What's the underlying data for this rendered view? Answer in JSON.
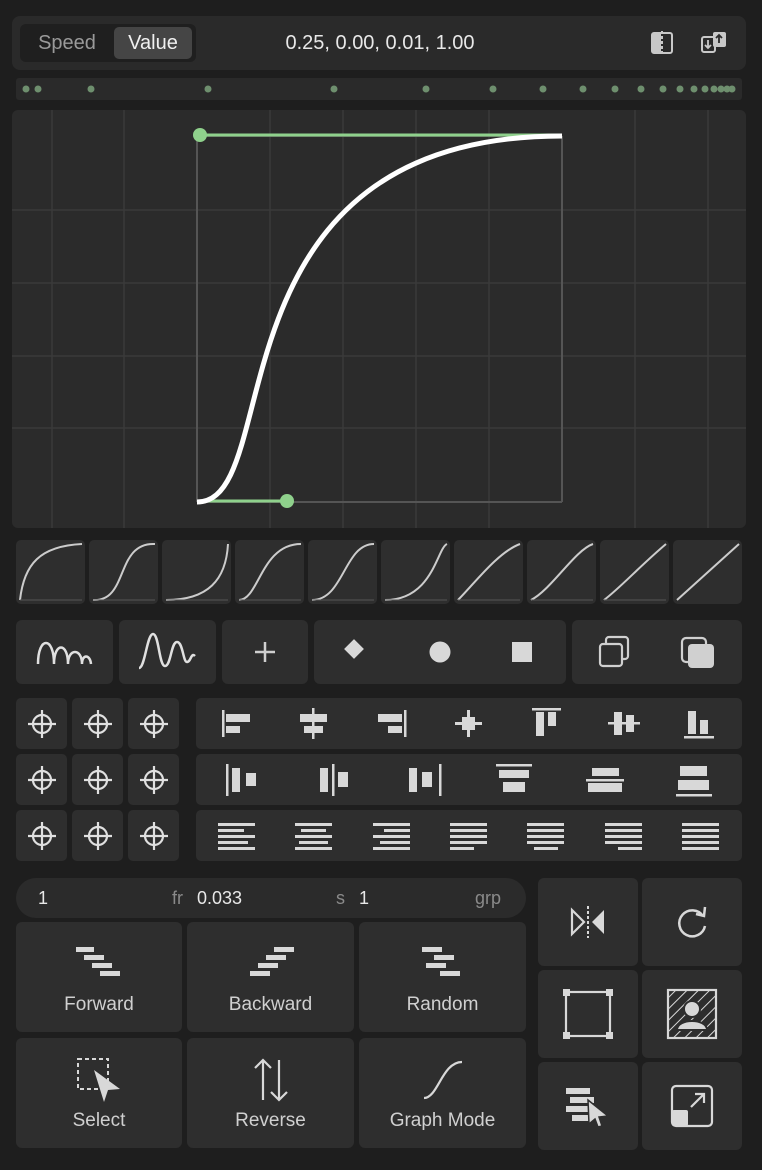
{
  "header": {
    "mode_tabs": [
      "Speed",
      "Value"
    ],
    "active_tab": "Value",
    "curve_values": "0.25, 0.00, 0.01, 1.00",
    "icons": [
      "split-view-icon",
      "swap-order-icon"
    ]
  },
  "colors": {
    "accent_green": "#8fd18c",
    "background": "#1e1e1e",
    "panel": "#2b2b2b",
    "curve": "#ffffff"
  },
  "graph": {
    "bezier": [
      0.25,
      0.0,
      0.01,
      1.0
    ]
  },
  "presets": {
    "icons": [
      "ease-out-icon",
      "ease-in-out-icon",
      "ease-in-icon",
      "ease-in-out-2-icon",
      "ease-in-out-3-icon",
      "ease-in-out-4-icon",
      "linear-ease-icon",
      "linear-ease-2-icon",
      "linear-ease-3-icon",
      "linear-icon"
    ]
  },
  "toolbar": {
    "icons": [
      "bounce-icon",
      "wiggle-icon",
      "add-icon",
      "diamond-keyframe-icon",
      "circle-keyframe-icon",
      "square-keyframe-icon",
      "copy-icon",
      "paste-icon"
    ]
  },
  "align_icons": [
    "align-left-icon",
    "align-center-h-icon",
    "align-right-icon",
    "center-cross-icon",
    "align-top-icon",
    "align-center-v-icon",
    "align-bottom-icon"
  ],
  "fields": {
    "offset_value": "1",
    "offset_unit": "fr",
    "duration_value": "0.033",
    "duration_unit": "s",
    "group_value": "1",
    "group_unit": "grp"
  },
  "actions": {
    "forward": "Forward",
    "backward": "Backward",
    "random": "Random",
    "select": "Select",
    "reverse": "Reverse",
    "graph_mode": "Graph Mode"
  },
  "side_icons": [
    "mirror-icon",
    "refresh-icon",
    "bounding-box-icon",
    "mask-person-icon",
    "layer-select-icon",
    "expand-icon"
  ]
}
